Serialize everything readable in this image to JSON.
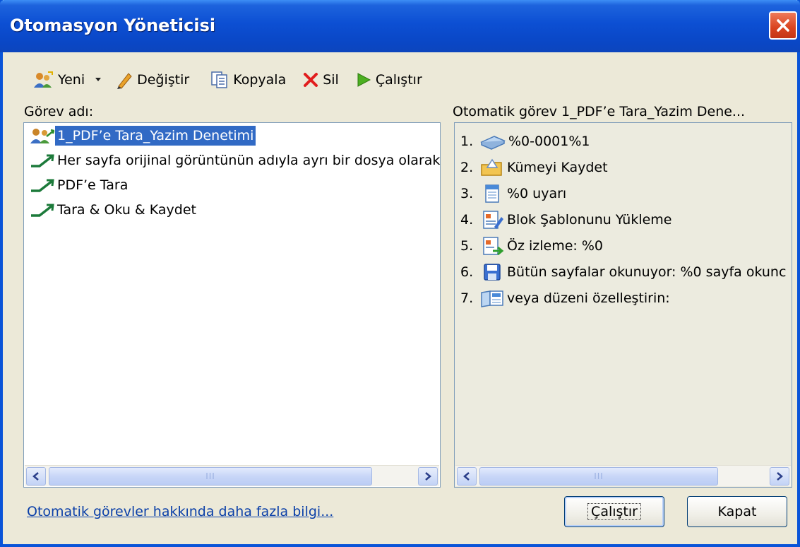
{
  "window": {
    "title": "Otomasyon Yöneticisi"
  },
  "toolbar": {
    "new_label": "Yeni",
    "edit_label": "Değiştir",
    "copy_label": "Kopyala",
    "delete_label": "Sil",
    "run_label": "Çalıştır"
  },
  "left_panel": {
    "header": "Görev adı:",
    "items": [
      "1_PDF’e Tara_Yazim Denetimi",
      "Her sayfa orijinal görüntünün adıyla ayrı bir dosya olarak",
      "PDF’e Tara",
      "Tara & Oku & Kaydet"
    ],
    "selected_index": 0
  },
  "right_panel": {
    "header": "Otomatik görev 1_PDF’e Tara_Yazim Dene...",
    "steps": [
      {
        "num": "1.",
        "icon": "scanner-icon",
        "text": "%0-0001%1"
      },
      {
        "num": "2.",
        "icon": "folder-save-icon",
        "text": "Kümeyi Kaydet"
      },
      {
        "num": "3.",
        "icon": "document-icon",
        "text": "%0 uyarı"
      },
      {
        "num": "4.",
        "icon": "template-icon",
        "text": "Blok Şablonunu Yükleme"
      },
      {
        "num": "5.",
        "icon": "image-arrow-icon",
        "text": "Öz izleme: %0"
      },
      {
        "num": "6.",
        "icon": "floppy-disk-icon",
        "text": "Bütün sayfalar okunuyor: %0 sayfa okunc"
      },
      {
        "num": "7.",
        "icon": "layout-icon",
        "text": "veya düzeni özelleştirin:"
      }
    ]
  },
  "footer": {
    "link": "Otomatik görevler hakkında daha fazla bilgi...",
    "run_button": "Çalıştır",
    "close_button": "Kapat"
  },
  "scrollbar_thumb_grip": "III"
}
